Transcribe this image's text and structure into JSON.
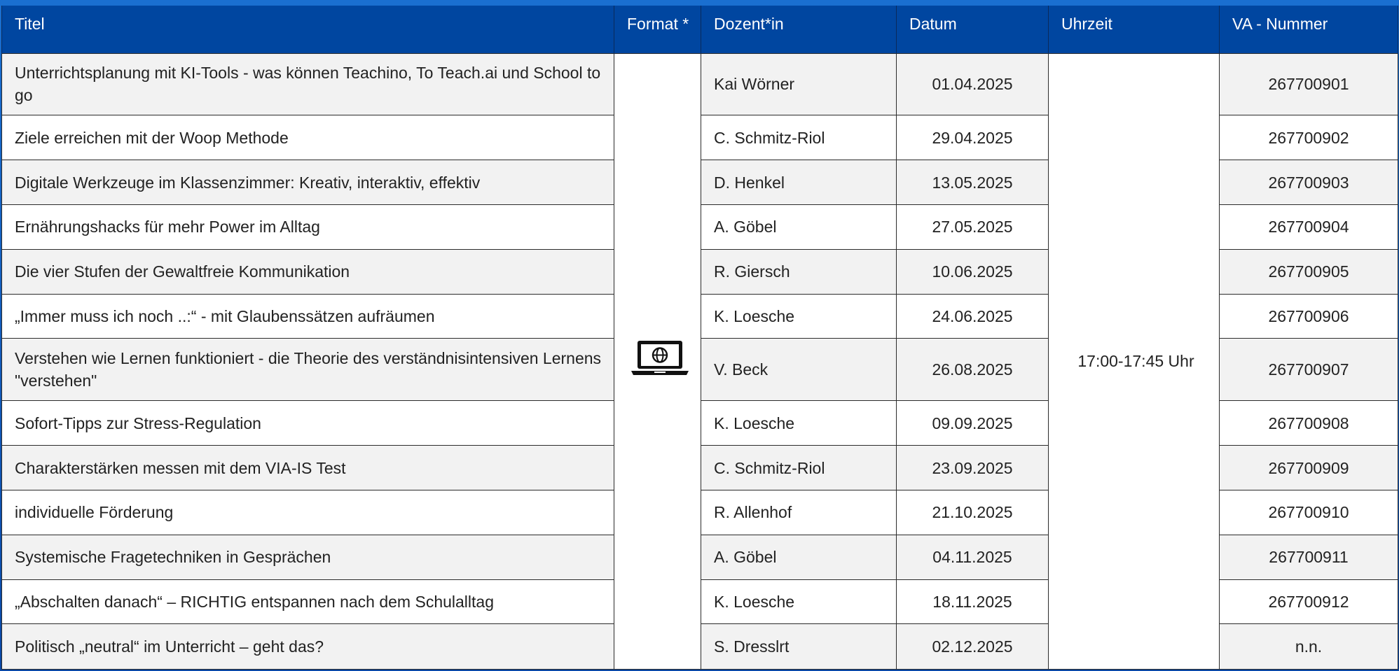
{
  "headers": {
    "titel": "Titel",
    "format": "Format *",
    "dozent": "Dozent*in",
    "datum": "Datum",
    "uhrzeit": "Uhrzeit",
    "va_nummer": "VA - Nummer"
  },
  "format_icon": "laptop-globe-icon",
  "uhrzeit_value": "17:00-17:45 Uhr",
  "rows": [
    {
      "titel": "Unterrichtsplanung mit KI-Tools - was können Teachino, To Teach.ai und School to go",
      "dozent": "Kai Wörner",
      "datum": "01.04.2025",
      "va": "267700901"
    },
    {
      "titel": "Ziele erreichen mit der Woop Methode",
      "dozent": "C. Schmitz-Riol",
      "datum": "29.04.2025",
      "va": "267700902"
    },
    {
      "titel": "Digitale Werkzeuge im Klassenzimmer: Kreativ, interaktiv, effektiv",
      "dozent": "D. Henkel",
      "datum": "13.05.2025",
      "va": "267700903"
    },
    {
      "titel": "Ernährungshacks für mehr Power im Alltag",
      "dozent": "A. Göbel",
      "datum": "27.05.2025",
      "va": "267700904"
    },
    {
      "titel": "Die vier Stufen der Gewaltfreie Kommunikation",
      "dozent": "R. Giersch",
      "datum": "10.06.2025",
      "va": "267700905"
    },
    {
      "titel": "„Immer muss ich noch ..:“ - mit Glaubenssätzen aufräumen",
      "dozent": "K. Loesche",
      "datum": "24.06.2025",
      "va": "267700906"
    },
    {
      "titel": "Verstehen wie Lernen funktioniert - die Theorie des verständnisintensiven Lernens \"verstehen\"",
      "dozent": "V. Beck",
      "datum": "26.08.2025",
      "va": "267700907"
    },
    {
      "titel": "Sofort-Tipps zur Stress-Regulation",
      "dozent": "K. Loesche",
      "datum": "09.09.2025",
      "va": "267700908"
    },
    {
      "titel": "Charakterstärken messen mit dem VIA-IS Test",
      "dozent": "C. Schmitz-Riol",
      "datum": "23.09.2025",
      "va": "267700909"
    },
    {
      "titel": "individuelle Förderung",
      "dozent": "R. Allenhof",
      "datum": "21.10.2025",
      "va": "267700910"
    },
    {
      "titel": "Systemische Fragetechniken in Gesprächen",
      "dozent": "A. Göbel",
      "datum": "04.11.2025",
      "va": "267700911"
    },
    {
      "titel": "„Abschalten danach“ – RICHTIG entspannen nach dem Schulalltag",
      "dozent": "K. Loesche",
      "datum": "18.11.2025",
      "va": "267700912"
    },
    {
      "titel": "Politisch „neutral“ im Unterricht – geht das?",
      "dozent": "S. Dresslrt",
      "datum": "02.12.2025",
      "va": "n.n."
    }
  ]
}
